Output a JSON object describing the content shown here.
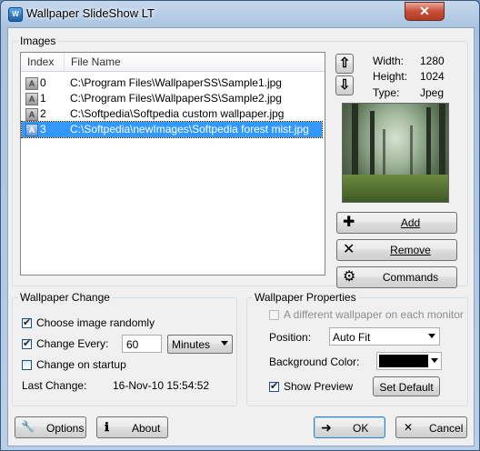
{
  "window": {
    "title": "Wallpaper SlideShow LT",
    "close_glyph": "✕",
    "icon_text": "W"
  },
  "images": {
    "group_label": "Images",
    "columns": [
      "Index",
      "File Name"
    ],
    "rows": [
      {
        "index": "0",
        "file": "C:\\Program Files\\WallpaperSS\\Sample1.jpg"
      },
      {
        "index": "1",
        "file": "C:\\Program Files\\WallpaperSS\\Sample2.jpg"
      },
      {
        "index": "2",
        "file": "C:\\Softpedia\\Softpedia custom wallpaper.jpg"
      },
      {
        "index": "3",
        "file": "C:\\Softpedia\\newImages\\Softpedia forest mist.jpg"
      }
    ],
    "selected_row": 3,
    "row_icon_glyph": "A"
  },
  "info": {
    "width_label": "Width:",
    "width_value": "1280",
    "height_label": "Height:",
    "height_value": "1024",
    "type_label": "Type:",
    "type_value": "Jpeg"
  },
  "actions": {
    "up_glyph": "⇧",
    "down_glyph": "⇩",
    "add_label": "Add",
    "add_icon_glyph": "✚",
    "remove_label": "Remove",
    "remove_icon_glyph": "✕",
    "commands_label": "Commands",
    "commands_icon_glyph": "⚙"
  },
  "wallpaper_change": {
    "group_label": "Wallpaper Change",
    "choose_random_label": "Choose image randomly",
    "choose_random_checked": true,
    "change_every_label": "Change Every:",
    "change_every_checked": true,
    "interval_value": "60",
    "interval_unit": "Minutes",
    "change_on_startup_label": "Change on startup",
    "change_on_startup_checked": false,
    "last_change_label": "Last Change:",
    "last_change_value": "16-Nov-10 15:54:52"
  },
  "wallpaper_properties": {
    "group_label": "Wallpaper Properties",
    "different_per_monitor_label": "A different wallpaper on each monitor",
    "position_label": "Position:",
    "position_value": "Auto Fit",
    "bg_color_label": "Background Color:",
    "bg_color_value": "#000000",
    "show_preview_label": "Show Preview",
    "show_preview_checked": true,
    "set_default_label": "Set Default"
  },
  "footer": {
    "options_label": "Options",
    "options_icon_glyph": "🔧",
    "about_label": "About",
    "about_icon_glyph": "ℹ",
    "ok_label": "OK",
    "ok_icon_glyph": "➜",
    "cancel_label": "Cancel",
    "cancel_icon_glyph": "✕"
  }
}
